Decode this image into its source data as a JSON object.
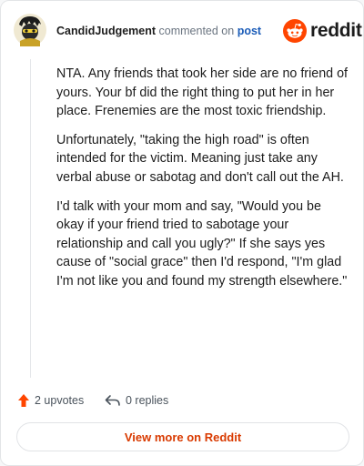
{
  "header": {
    "username": "CandidJudgement",
    "action_text": "commented on",
    "post_link": "post",
    "brand": "reddit"
  },
  "comment": {
    "paragraphs": [
      "NTA. Any friends that took her side are no friend of yours. Your bf did the right thing to put her in her place. Frenemies are the most toxic friendship.",
      "Unfortunately, \"taking the high road\" is often intended for the victim. Meaning just take any verbal abuse or sabotag and don't call out the AH.",
      "I'd talk with your mom and say, \"Would you be okay if your friend tried to sabotage your relationship and call you ugly?\" If she says yes cause of \"social grace\" then I'd respond, \"I'm glad I'm not like you and found my strength elsewhere.\""
    ]
  },
  "actions": {
    "upvotes": "2 upvotes",
    "replies": "0 replies"
  },
  "footer": {
    "view_button": "View more on Reddit"
  },
  "colors": {
    "brand_orange": "#ff4500",
    "link_blue": "#1b5cb8",
    "button_text": "#d93a00"
  },
  "icons": [
    "avatar-icon",
    "reddit-logo-icon",
    "upvote-arrow-icon",
    "reply-arrow-icon"
  ]
}
